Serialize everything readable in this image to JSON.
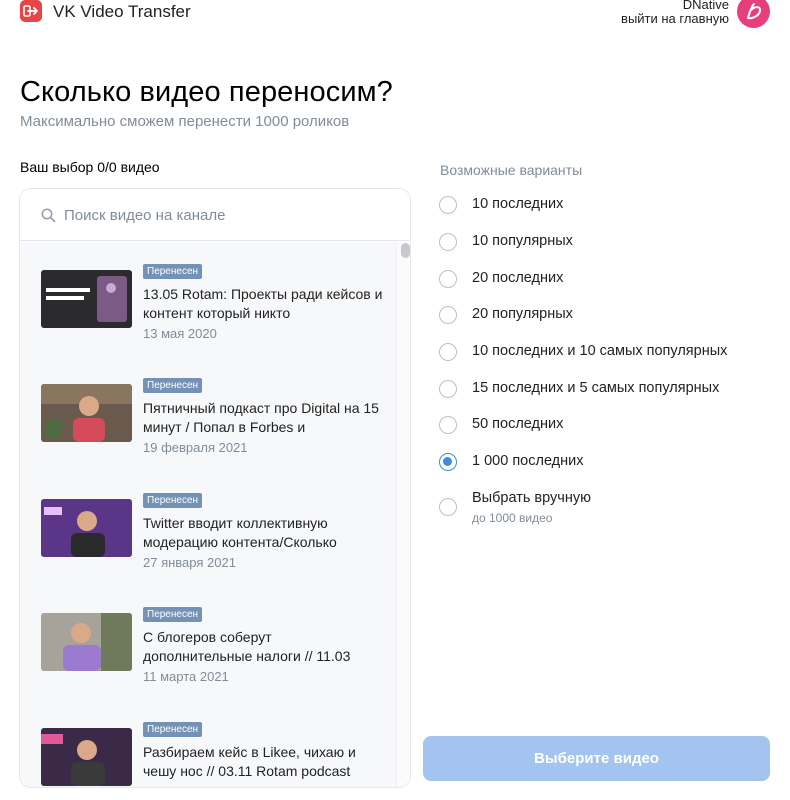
{
  "header": {
    "app_title": "VK Video Transfer",
    "logo_icon": "transfer-arrow-icon",
    "user_name": "DNative",
    "logout_label": "выйти на главную",
    "avatar_icon": "dnative-logo-icon"
  },
  "page": {
    "title": "Сколько видео переносим?",
    "subtitle": "Максимально сможем перенести 1000 роликов"
  },
  "selection": {
    "count_label": "Ваш выбор 0/0 видео"
  },
  "search": {
    "icon": "search-icon",
    "placeholder": "Поиск видео на канале"
  },
  "videos": [
    {
      "badge": "Перенесен",
      "title": "13.05 Rotam: Проекты ради кейсов и контент который никто",
      "date": "13 мая 2020"
    },
    {
      "badge": "Перенесен",
      "title": "Пятничный подкаст про Digital на 15 минут / Попал в Forbes и",
      "date": "19 февраля 2021"
    },
    {
      "badge": "Перенесен",
      "title": "Twitter вводит коллективную модерацию контента/Сколько",
      "date": "27 января 2021"
    },
    {
      "badge": "Перенесен",
      "title": "С блогеров соберут дополнительные налоги // 11.03",
      "date": "11 марта 2021"
    },
    {
      "badge": "Перенесен",
      "title": "Разбираем кейс в Likee, чихаю и чешу нос // 03.11 Rotam podcast",
      "date": ""
    }
  ],
  "options": {
    "heading": "Возможные варианты",
    "items": [
      {
        "label": "10 последних",
        "checked": false
      },
      {
        "label": "10 популярных",
        "checked": false
      },
      {
        "label": "20 последних",
        "checked": false
      },
      {
        "label": "20 популярных",
        "checked": false
      },
      {
        "label": "10 последних и 10 самых популярных",
        "checked": false
      },
      {
        "label": "15 последних и 5 самых популярных",
        "checked": false
      },
      {
        "label": "50 последних",
        "checked": false
      },
      {
        "label": "1 000 последних",
        "checked": true
      },
      {
        "label": "Выбрать вручную",
        "sub": "до 1000 видео",
        "checked": false
      }
    ]
  },
  "submit": {
    "label": "Выберите видео"
  },
  "colors": {
    "accent": "#3f8ae0",
    "button_disabled": "#a3c4ee",
    "badge": "#7392b5",
    "logo": "#e64646",
    "avatar": "#e6407c",
    "muted_text": "#818c99"
  }
}
